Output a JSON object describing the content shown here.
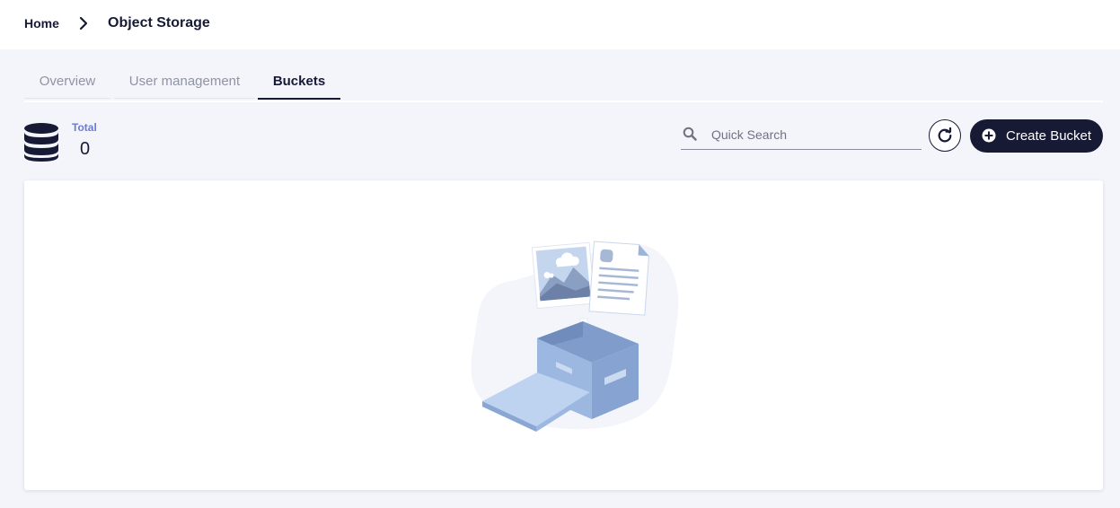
{
  "breadcrumb": {
    "home": "Home",
    "separator_icon": "chevron-right-icon",
    "current": "Object Storage"
  },
  "tabs": [
    {
      "label": "Overview",
      "active": false
    },
    {
      "label": "User management",
      "active": false
    },
    {
      "label": "Buckets",
      "active": true
    }
  ],
  "summary": {
    "icon": "database-icon",
    "total_label": "Total",
    "total_value": "0"
  },
  "search": {
    "icon": "search-icon",
    "placeholder": "Quick Search",
    "value": ""
  },
  "toolbar": {
    "refresh_icon": "refresh-icon",
    "create_label": "Create Bucket",
    "create_icon": "plus-circle-icon"
  },
  "empty_state": {
    "illustration": "empty-box-illustration"
  },
  "colors": {
    "primary": "#171a35",
    "accent": "#6b7bd0",
    "background": "#f4f5fb",
    "illustration": "#8fb1dc"
  }
}
